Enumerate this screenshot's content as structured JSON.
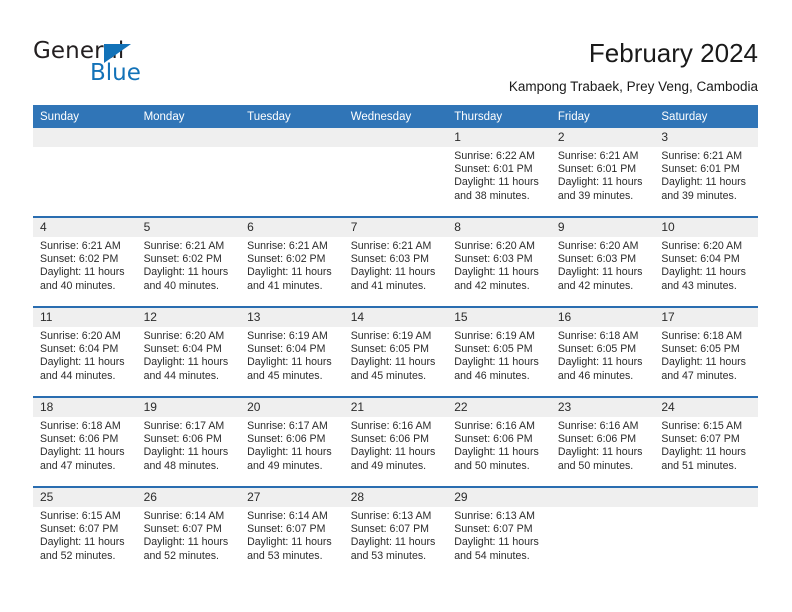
{
  "brand": {
    "name_part1": "General",
    "name_part2": "Blue",
    "triangle_color": "#1272b8",
    "accent_color": "#3075b7"
  },
  "header": {
    "title": "February 2024",
    "subtitle": "Kampong Trabaek, Prey Veng, Cambodia"
  },
  "calendar": {
    "weekday_headers": [
      "Sunday",
      "Monday",
      "Tuesday",
      "Wednesday",
      "Thursday",
      "Friday",
      "Saturday"
    ],
    "weeks": [
      [
        {
          "day": "",
          "lines": []
        },
        {
          "day": "",
          "lines": []
        },
        {
          "day": "",
          "lines": []
        },
        {
          "day": "",
          "lines": []
        },
        {
          "day": "1",
          "lines": [
            "Sunrise: 6:22 AM",
            "Sunset: 6:01 PM",
            "Daylight: 11 hours",
            "and 38 minutes."
          ]
        },
        {
          "day": "2",
          "lines": [
            "Sunrise: 6:21 AM",
            "Sunset: 6:01 PM",
            "Daylight: 11 hours",
            "and 39 minutes."
          ]
        },
        {
          "day": "3",
          "lines": [
            "Sunrise: 6:21 AM",
            "Sunset: 6:01 PM",
            "Daylight: 11 hours",
            "and 39 minutes."
          ]
        }
      ],
      [
        {
          "day": "4",
          "lines": [
            "Sunrise: 6:21 AM",
            "Sunset: 6:02 PM",
            "Daylight: 11 hours",
            "and 40 minutes."
          ]
        },
        {
          "day": "5",
          "lines": [
            "Sunrise: 6:21 AM",
            "Sunset: 6:02 PM",
            "Daylight: 11 hours",
            "and 40 minutes."
          ]
        },
        {
          "day": "6",
          "lines": [
            "Sunrise: 6:21 AM",
            "Sunset: 6:02 PM",
            "Daylight: 11 hours",
            "and 41 minutes."
          ]
        },
        {
          "day": "7",
          "lines": [
            "Sunrise: 6:21 AM",
            "Sunset: 6:03 PM",
            "Daylight: 11 hours",
            "and 41 minutes."
          ]
        },
        {
          "day": "8",
          "lines": [
            "Sunrise: 6:20 AM",
            "Sunset: 6:03 PM",
            "Daylight: 11 hours",
            "and 42 minutes."
          ]
        },
        {
          "day": "9",
          "lines": [
            "Sunrise: 6:20 AM",
            "Sunset: 6:03 PM",
            "Daylight: 11 hours",
            "and 42 minutes."
          ]
        },
        {
          "day": "10",
          "lines": [
            "Sunrise: 6:20 AM",
            "Sunset: 6:04 PM",
            "Daylight: 11 hours",
            "and 43 minutes."
          ]
        }
      ],
      [
        {
          "day": "11",
          "lines": [
            "Sunrise: 6:20 AM",
            "Sunset: 6:04 PM",
            "Daylight: 11 hours",
            "and 44 minutes."
          ]
        },
        {
          "day": "12",
          "lines": [
            "Sunrise: 6:20 AM",
            "Sunset: 6:04 PM",
            "Daylight: 11 hours",
            "and 44 minutes."
          ]
        },
        {
          "day": "13",
          "lines": [
            "Sunrise: 6:19 AM",
            "Sunset: 6:04 PM",
            "Daylight: 11 hours",
            "and 45 minutes."
          ]
        },
        {
          "day": "14",
          "lines": [
            "Sunrise: 6:19 AM",
            "Sunset: 6:05 PM",
            "Daylight: 11 hours",
            "and 45 minutes."
          ]
        },
        {
          "day": "15",
          "lines": [
            "Sunrise: 6:19 AM",
            "Sunset: 6:05 PM",
            "Daylight: 11 hours",
            "and 46 minutes."
          ]
        },
        {
          "day": "16",
          "lines": [
            "Sunrise: 6:18 AM",
            "Sunset: 6:05 PM",
            "Daylight: 11 hours",
            "and 46 minutes."
          ]
        },
        {
          "day": "17",
          "lines": [
            "Sunrise: 6:18 AM",
            "Sunset: 6:05 PM",
            "Daylight: 11 hours",
            "and 47 minutes."
          ]
        }
      ],
      [
        {
          "day": "18",
          "lines": [
            "Sunrise: 6:18 AM",
            "Sunset: 6:06 PM",
            "Daylight: 11 hours",
            "and 47 minutes."
          ]
        },
        {
          "day": "19",
          "lines": [
            "Sunrise: 6:17 AM",
            "Sunset: 6:06 PM",
            "Daylight: 11 hours",
            "and 48 minutes."
          ]
        },
        {
          "day": "20",
          "lines": [
            "Sunrise: 6:17 AM",
            "Sunset: 6:06 PM",
            "Daylight: 11 hours",
            "and 49 minutes."
          ]
        },
        {
          "day": "21",
          "lines": [
            "Sunrise: 6:16 AM",
            "Sunset: 6:06 PM",
            "Daylight: 11 hours",
            "and 49 minutes."
          ]
        },
        {
          "day": "22",
          "lines": [
            "Sunrise: 6:16 AM",
            "Sunset: 6:06 PM",
            "Daylight: 11 hours",
            "and 50 minutes."
          ]
        },
        {
          "day": "23",
          "lines": [
            "Sunrise: 6:16 AM",
            "Sunset: 6:06 PM",
            "Daylight: 11 hours",
            "and 50 minutes."
          ]
        },
        {
          "day": "24",
          "lines": [
            "Sunrise: 6:15 AM",
            "Sunset: 6:07 PM",
            "Daylight: 11 hours",
            "and 51 minutes."
          ]
        }
      ],
      [
        {
          "day": "25",
          "lines": [
            "Sunrise: 6:15 AM",
            "Sunset: 6:07 PM",
            "Daylight: 11 hours",
            "and 52 minutes."
          ]
        },
        {
          "day": "26",
          "lines": [
            "Sunrise: 6:14 AM",
            "Sunset: 6:07 PM",
            "Daylight: 11 hours",
            "and 52 minutes."
          ]
        },
        {
          "day": "27",
          "lines": [
            "Sunrise: 6:14 AM",
            "Sunset: 6:07 PM",
            "Daylight: 11 hours",
            "and 53 minutes."
          ]
        },
        {
          "day": "28",
          "lines": [
            "Sunrise: 6:13 AM",
            "Sunset: 6:07 PM",
            "Daylight: 11 hours",
            "and 53 minutes."
          ]
        },
        {
          "day": "29",
          "lines": [
            "Sunrise: 6:13 AM",
            "Sunset: 6:07 PM",
            "Daylight: 11 hours",
            "and 54 minutes."
          ]
        },
        {
          "day": "",
          "lines": []
        },
        {
          "day": "",
          "lines": []
        }
      ]
    ]
  }
}
